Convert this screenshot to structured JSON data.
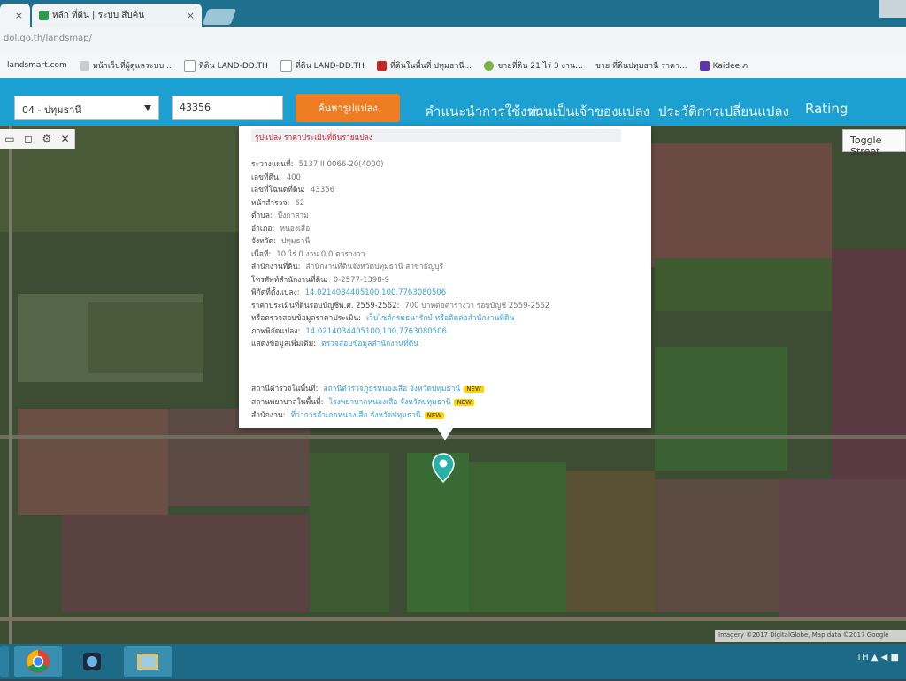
{
  "browser": {
    "tabs": [
      {
        "label": "หลัก ที่ดิน | ระบบ สืบค้น",
        "close": "×"
      }
    ],
    "first_tab_close": "×",
    "url": "dol.go.th/landsmap/",
    "bookmarks": [
      {
        "label": "landsmart.com"
      },
      {
        "label": "หน้าเว็บที่ผู้ดูแลระบบ..."
      },
      {
        "label": "ที่ดิน LAND-DD.TH"
      },
      {
        "label": "ที่ดิน LAND-DD.TH"
      },
      {
        "label": "ที่ดินในพื้นที่ ปทุมธานี..."
      },
      {
        "label": "ขายที่ดิน 21 ไร่ 3 งาน..."
      },
      {
        "label": "ขาย ที่ดินปทุมธานี ราคา..."
      },
      {
        "label": "Kaidee ภ"
      }
    ]
  },
  "header": {
    "province_select": "04 - ปทุมธานี",
    "parcel_number": "43356",
    "search_button": "ค้นหารูปแปลง",
    "nav": [
      "คำแนะนำการใช้งาน",
      "ท่านเป็นเจ้าของแปลง",
      "ประวัติการเปลี่ยนแปลง",
      "Rating"
    ]
  },
  "map": {
    "toggle_button": "Toggle Street",
    "attribution": "Imagery ©2017 DigitalGlobe, Map data ©2017 Google",
    "tools": [
      "▭",
      "◻",
      "⚙",
      "✕"
    ]
  },
  "popup": {
    "header": "รูปแปลง ราคาประเมินที่ดินรายแปลง",
    "rows": [
      {
        "label": "ระวางแผนที่:",
        "value": "5137 II 0066-20(4000)"
      },
      {
        "label": "เลขที่ดิน:",
        "value": "400"
      },
      {
        "label": "เลขที่โฉนดที่ดิน:",
        "value": "43356"
      },
      {
        "label": "หน้าสำรวจ:",
        "value": "62"
      },
      {
        "label": "ตำบล:",
        "value": "บึงกาสาม"
      },
      {
        "label": "อำเภอ:",
        "value": "หนองเสือ"
      },
      {
        "label": "จังหวัด:",
        "value": "ปทุมธานี"
      },
      {
        "label": "เนื้อที่:",
        "value": "10 ไร่ 0 งาน 0.0 ตารางวา"
      },
      {
        "label": "สำนักงานที่ดิน:",
        "value": "สำนักงานที่ดินจังหวัดปทุมธานี สาขาธัญบุรี"
      },
      {
        "label": "โทรศัพท์สำนักงานที่ดิน:",
        "value": "0-2577-1398-9"
      },
      {
        "label": "พิกัดที่ตั้งแปลง:",
        "value": "14.0214034405100,100.7763080506",
        "link": true
      },
      {
        "label": "ราคาประเมินที่ดินรอบบัญชีพ.ศ. 2559-2562:",
        "value": "700 บาทต่อตารางวา รอบบัญชี 2559-2562"
      },
      {
        "label": "หรือตรวจสอบข้อมูลราคาประเมิน:",
        "value": "เว็บไซต์กรมธนารักษ์ หรือติดต่อสำนักงานที่ดิน",
        "link": true
      },
      {
        "label": "ภาพพิกัดแปลง:",
        "value": "14.0214034405100,100.7763080506",
        "link": true
      },
      {
        "label": "แสดงข้อมูลเพิ่มเติม:",
        "value": "ตรวจสอบข้อมูลสำนักงานที่ดิน",
        "link": true
      }
    ],
    "links": [
      {
        "label": "สถานีตำรวจในพื้นที่:",
        "value": "สถานีตำรวจภูธรหนองเสือ จังหวัดปทุมธานี",
        "badge": "NEW"
      },
      {
        "label": "สถานพยาบาลในพื้นที่:",
        "value": "โรงพยาบาลหนองเสือ จังหวัดปทุมธานี",
        "badge": "NEW"
      },
      {
        "label": "สำนักงาน:",
        "value": "ที่ว่าการอำเภอหนองเสือ จังหวัดปทุมธานี",
        "badge": "NEW"
      }
    ]
  },
  "taskbar": {
    "tray": "TH ▲ ◀ ■"
  }
}
